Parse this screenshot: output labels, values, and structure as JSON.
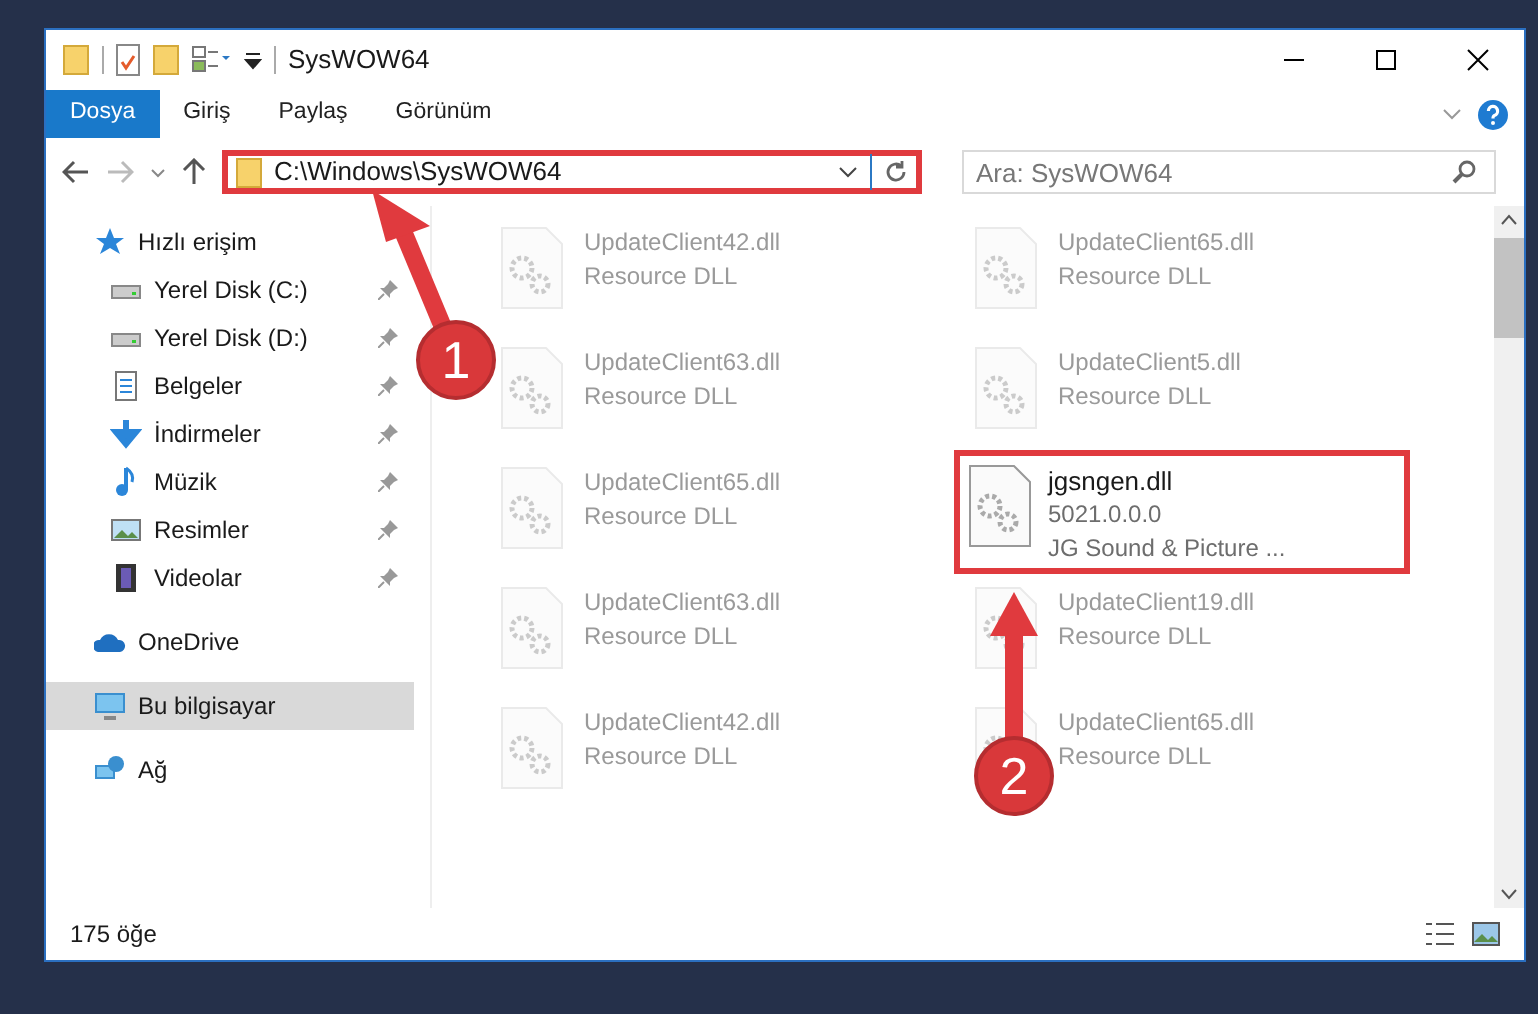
{
  "window": {
    "title": "SysWOW64"
  },
  "ribbon_tabs": [
    {
      "label": "Dosya",
      "selected": true
    },
    {
      "label": "Giriş",
      "selected": false
    },
    {
      "label": "Paylaş",
      "selected": false
    },
    {
      "label": "Görünüm",
      "selected": false
    }
  ],
  "address": {
    "path": "C:\\Windows\\SysWOW64"
  },
  "search": {
    "placeholder": "Ara: SysWOW64"
  },
  "sidebar": {
    "items": [
      {
        "label": "Hızlı erişim",
        "kind": "star",
        "selected": false,
        "children": [
          {
            "label": "Yerel Disk (C:)",
            "kind": "drive",
            "pinned": true,
            "selected": false
          },
          {
            "label": "Yerel Disk (D:)",
            "kind": "drive",
            "pinned": true,
            "selected": false
          },
          {
            "label": "Belgeler",
            "kind": "doc",
            "pinned": true,
            "selected": false
          },
          {
            "label": "İndirmeler",
            "kind": "download",
            "pinned": true,
            "selected": false
          },
          {
            "label": "Müzik",
            "kind": "music",
            "pinned": true,
            "selected": false
          },
          {
            "label": "Resimler",
            "kind": "picture",
            "pinned": true,
            "selected": false
          },
          {
            "label": "Videolar",
            "kind": "video",
            "pinned": true,
            "selected": false
          }
        ]
      },
      {
        "label": "OneDrive",
        "kind": "cloud",
        "selected": false
      },
      {
        "label": "Bu bilgisayar",
        "kind": "pc",
        "selected": true
      },
      {
        "label": "Ağ",
        "kind": "network",
        "selected": false
      }
    ]
  },
  "files": [
    {
      "name": "UpdateClient42.dll",
      "details": [
        "Resource DLL"
      ],
      "blurred": true
    },
    {
      "name": "UpdateClient65.dll",
      "details": [
        "Resource DLL"
      ],
      "blurred": true
    },
    {
      "name": "UpdateClient63.dll",
      "details": [
        "Resource DLL"
      ],
      "blurred": true
    },
    {
      "name": "UpdateClient5.dll",
      "details": [
        "Resource DLL"
      ],
      "blurred": true
    },
    {
      "name": "UpdateClient65.dll",
      "details": [
        "Resource DLL"
      ],
      "blurred": true
    },
    {
      "name": "jgsngen.dll",
      "details": [
        "5021.0.0.0",
        "JG Sound & Picture ..."
      ],
      "blurred": false
    },
    {
      "name": "UpdateClient63.dll",
      "details": [
        "Resource DLL"
      ],
      "blurred": true
    },
    {
      "name": "UpdateClient19.dll",
      "details": [
        "Resource DLL"
      ],
      "blurred": true
    },
    {
      "name": "UpdateClient42.dll",
      "details": [
        "Resource DLL"
      ],
      "blurred": true
    },
    {
      "name": "UpdateClient65.dll",
      "details": [
        "Resource DLL"
      ],
      "blurred": true
    }
  ],
  "status_bar": {
    "count": "175 öğe"
  },
  "annotations": [
    {
      "label": "1"
    },
    {
      "label": "2"
    }
  ]
}
